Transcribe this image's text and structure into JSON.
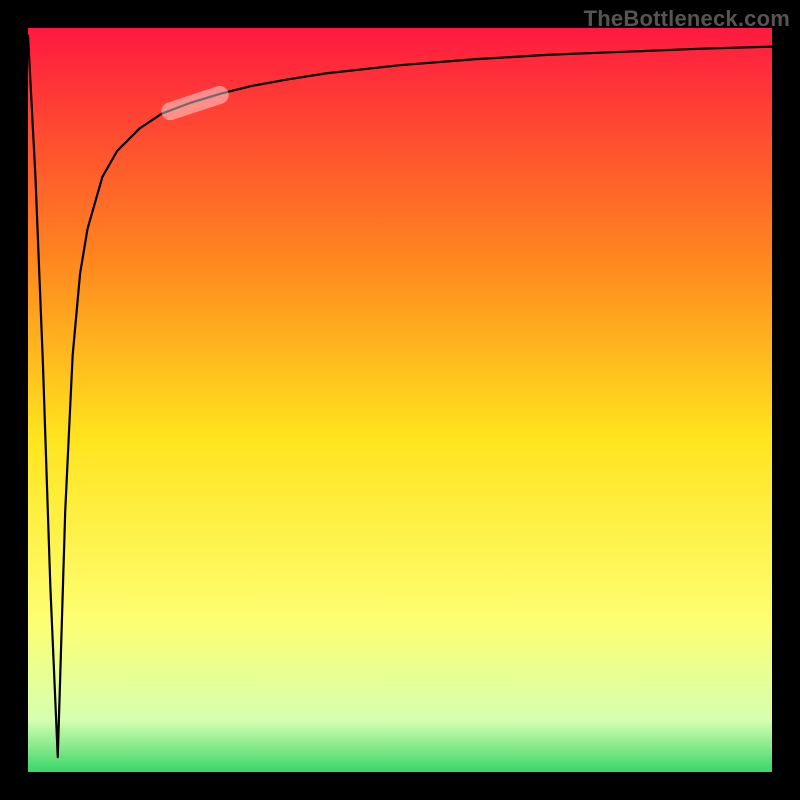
{
  "watermark_text": "TheBottleneck.com",
  "colors": {
    "frame": "#000000",
    "gradient_top": "#ff1940",
    "gradient_upper_mid": "#ff8a1e",
    "gradient_mid": "#ffe41e",
    "gradient_lower_mid": "#fdff73",
    "gradient_near_bottom": "#d6ffb0",
    "gradient_bottom": "#3ad66a",
    "curve": "#000000",
    "marker": "rgba(255,255,255,0.42)"
  },
  "chart_data": {
    "type": "line",
    "title": "",
    "xlabel": "",
    "ylabel": "",
    "xlim": [
      0,
      100
    ],
    "ylim": [
      0,
      100
    ],
    "dip_x": 4.0,
    "series": [
      {
        "name": "curve",
        "x": [
          0,
          1,
          2,
          3,
          4,
          5,
          6,
          7,
          8,
          10,
          12,
          15,
          18,
          22,
          26,
          30,
          35,
          40,
          50,
          60,
          70,
          80,
          90,
          100
        ],
        "values": [
          99.0,
          80.0,
          55.0,
          25.0,
          2.0,
          35.0,
          56.0,
          67.0,
          73.0,
          80.0,
          83.5,
          86.5,
          88.5,
          90.0,
          91.2,
          92.2,
          93.1,
          93.9,
          95.0,
          95.8,
          96.4,
          96.8,
          97.2,
          97.5
        ]
      }
    ],
    "highlight_segment": {
      "x_start": 18,
      "x_end": 27
    },
    "annotations": []
  }
}
